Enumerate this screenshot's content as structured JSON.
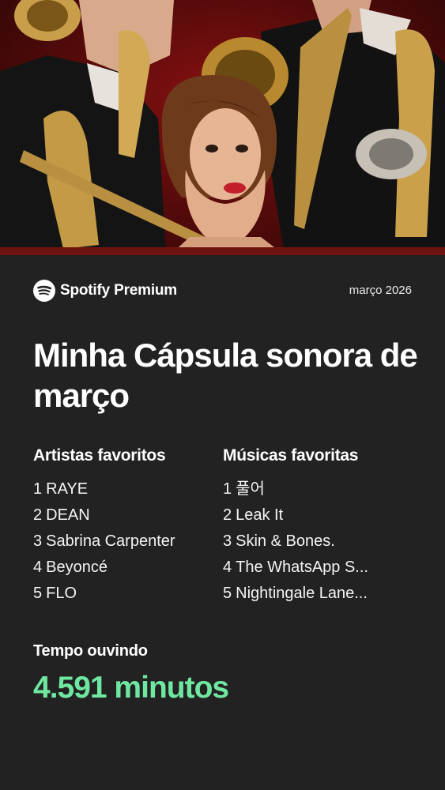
{
  "cover": {
    "image": "jazz-band-with-saxophones-and-woman-photo"
  },
  "brand": {
    "name": "Spotify",
    "tier": "Premium",
    "icon": "spotify-logo-icon"
  },
  "date": "março 2026",
  "title": "Minha Cápsula sonora de março",
  "artists": {
    "heading": "Artistas favoritos",
    "items": [
      {
        "rank": "1",
        "name": "RAYE"
      },
      {
        "rank": "2",
        "name": "DEAN"
      },
      {
        "rank": "3",
        "name": "Sabrina Carpenter"
      },
      {
        "rank": "4",
        "name": "Beyoncé"
      },
      {
        "rank": "5",
        "name": "FLO"
      }
    ]
  },
  "songs": {
    "heading": "Músicas favoritas",
    "items": [
      {
        "rank": "1",
        "name": "풀어"
      },
      {
        "rank": "2",
        "name": "Leak It"
      },
      {
        "rank": "3",
        "name": "Skin & Bones."
      },
      {
        "rank": "4",
        "name": "The WhatsApp S..."
      },
      {
        "rank": "5",
        "name": "Nightingale Lane..."
      }
    ]
  },
  "listening": {
    "label": "Tempo ouvindo",
    "value": "4.591 minutos"
  },
  "colors": {
    "background": "#222222",
    "accent": "#6fe7a0",
    "cover_red": "#8a1111"
  }
}
